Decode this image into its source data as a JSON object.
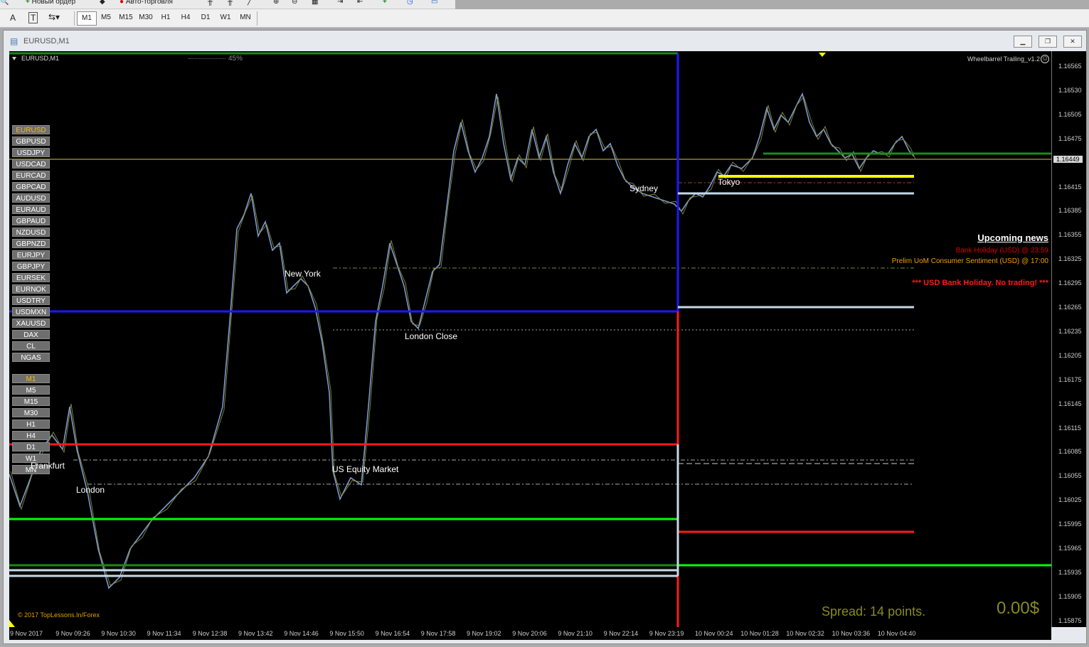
{
  "toolbar": {
    "new_order": "Новый ордер",
    "autotrading": "Авто-торговля",
    "text_tool": "A",
    "label_tool": "T",
    "timeframes": [
      "M1",
      "M5",
      "M15",
      "M30",
      "H1",
      "H4",
      "D1",
      "W1",
      "MN"
    ],
    "active_timeframe": "M1"
  },
  "window": {
    "title": "EURUSD,M1",
    "minimize": "▁",
    "restore": "❐",
    "close": "✕"
  },
  "chart": {
    "symbol_label": "EURUSD,M1",
    "progress_label": "45%",
    "progress_value": 45,
    "ea_name": "Wheelbarrel Trailing_v1.2",
    "current_price": "1.16449",
    "symbols": [
      "EURUSD",
      "GBPUSD",
      "USDJPY",
      "USDCAD",
      "EURCAD",
      "GBPCAD",
      "AUDUSD",
      "EURAUD",
      "GBPAUD",
      "NZDUSD",
      "GBPNZD",
      "EURJPY",
      "GBPJPY",
      "EURSEK",
      "EURNOK",
      "USDTRY",
      "USDMXN",
      "XAUUSD",
      "DAX",
      "CL",
      "NGAS"
    ],
    "selected_symbol": "EURUSD",
    "tf_buttons": [
      "M1",
      "M5",
      "M15",
      "M30",
      "H1",
      "H4",
      "D1",
      "W1",
      "MN"
    ],
    "selected_tf": "M1",
    "sessions": {
      "frankfurt": "Frankfurt",
      "london": "London",
      "new_york": "New York",
      "us_equity": "US Equity Market",
      "london_close": "London Close",
      "sydney": "Sydney",
      "tokyo": "Tokyo"
    },
    "news": {
      "title": "Upcoming news",
      "item1": "Bank Holiday (USD) @ 23:59",
      "item2": "Prelim UoM Consumer Sentiment (USD) @ 17:00",
      "warning": "*** USD Bank Holiday. No trading! ***"
    },
    "spread": "Spread: 14 points.",
    "profit": "0.00$",
    "copyright": "© 2017 TopLessons.In/Forex",
    "price_labels": [
      "1.16565",
      "1.16530",
      "1.16505",
      "1.16475",
      "1.16449",
      "1.16415",
      "1.16385",
      "1.16355",
      "1.16325",
      "1.16295",
      "1.16265",
      "1.16235",
      "1.16205",
      "1.16175",
      "1.16145",
      "1.16115",
      "1.16085",
      "1.16055",
      "1.16025",
      "1.15995",
      "1.15965",
      "1.15935",
      "1.15905",
      "1.15875"
    ],
    "time_labels": [
      "9 Nov 2017",
      "9 Nov 09:26",
      "9 Nov 10:30",
      "9 Nov 11:34",
      "9 Nov 12:38",
      "9 Nov 13:42",
      "9 Nov 14:46",
      "9 Nov 15:50",
      "9 Nov 16:54",
      "9 Nov 17:58",
      "9 Nov 19:02",
      "9 Nov 20:06",
      "9 Nov 21:10",
      "9 Nov 22:14",
      "9 Nov 23:19",
      "10 Nov 00:24",
      "10 Nov 01:28",
      "10 Nov 02:32",
      "10 Nov 03:36",
      "10 Nov 04:40"
    ],
    "colors": {
      "background": "#000000",
      "candles": "#7b9ad0",
      "candles_alt": "#8a8a3a",
      "blue_level": "#1a1aff",
      "red_level": "#ff1a1a",
      "green_level": "#00ff00",
      "dark_green": "#1c8a1c",
      "yellow_level": "#ffff00",
      "silver_level": "#c6d8e6"
    }
  }
}
